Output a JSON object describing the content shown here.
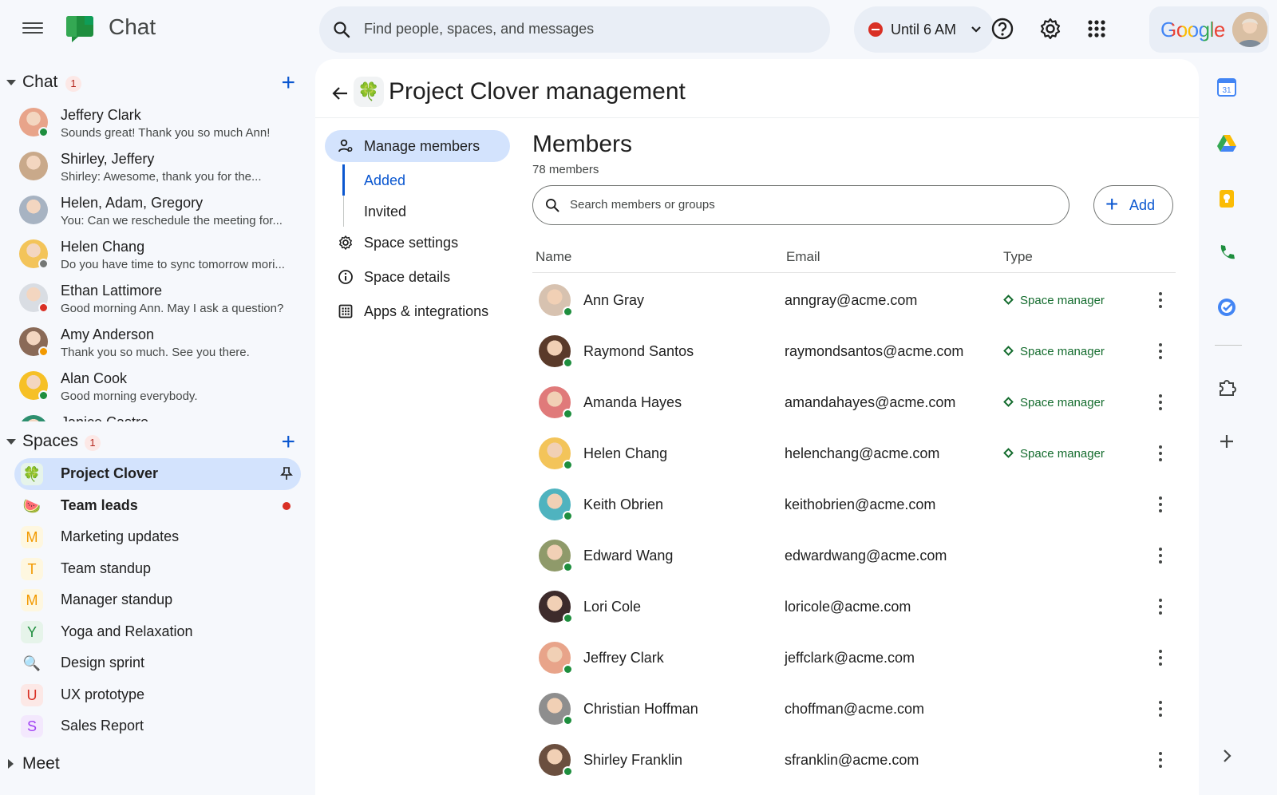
{
  "app": {
    "title": "Chat"
  },
  "search": {
    "placeholder": "Find people, spaces, and messages"
  },
  "status": {
    "label": "Until 6 AM"
  },
  "brand": {
    "google": "Google"
  },
  "sidebar": {
    "chat_section": {
      "title": "Chat",
      "badge": "1"
    },
    "dms": [
      {
        "name": "Jeffery Clark",
        "message": "Sounds great! Thank you so much Ann!",
        "color": "#e8a48a",
        "presence": "#1e8e3e"
      },
      {
        "name": "Shirley, Jeffery",
        "message": "Shirley: Awesome, thank you for the...",
        "color": "#c9a98a",
        "presence": ""
      },
      {
        "name": "Helen, Adam, Gregory",
        "message": "You: Can we reschedule the meeting for...",
        "color": "#a7b3c2",
        "presence": ""
      },
      {
        "name": "Helen Chang",
        "message": "Do you have time to sync tomorrow mori...",
        "color": "#f3c45a",
        "presence": "#747775"
      },
      {
        "name": "Ethan Lattimore",
        "message": "Good morning Ann. May I ask a question?",
        "color": "#d9dde3",
        "presence": "#d93025"
      },
      {
        "name": "Amy Anderson",
        "message": "Thank you so much. See you there.",
        "color": "#8a6a57",
        "presence": "#f29900"
      },
      {
        "name": "Alan Cook",
        "message": "Good morning everybody.",
        "color": "#f6c026",
        "presence": "#1e8e3e"
      },
      {
        "name": "Janice Castro",
        "message": "",
        "color": "#2d8f6f",
        "presence": ""
      }
    ],
    "spaces_section": {
      "title": "Spaces",
      "badge": "1"
    },
    "spaces": [
      {
        "name": "Project Clover",
        "icon": "🍀",
        "letter_color": "#1e8e3e",
        "bg": "#e6f4ea",
        "active": true,
        "bold": true,
        "unread": false
      },
      {
        "name": "Team leads",
        "icon": "🍉",
        "letter_color": "#d93025",
        "bg": "transparent",
        "active": false,
        "bold": true,
        "unread": true
      },
      {
        "name": "Marketing updates",
        "icon": "M",
        "letter_color": "#f29900",
        "bg": "#fef7e0",
        "active": false,
        "bold": false,
        "unread": false
      },
      {
        "name": "Team standup",
        "icon": "T",
        "letter_color": "#f29900",
        "bg": "#fef7e0",
        "active": false,
        "bold": false,
        "unread": false
      },
      {
        "name": "Manager standup",
        "icon": "M",
        "letter_color": "#f29900",
        "bg": "#fef7e0",
        "active": false,
        "bold": false,
        "unread": false
      },
      {
        "name": "Yoga and Relaxation",
        "icon": "Y",
        "letter_color": "#1e8e3e",
        "bg": "#e6f4ea",
        "active": false,
        "bold": false,
        "unread": false
      },
      {
        "name": "Design sprint",
        "icon": "🔍",
        "letter_color": "#d93025",
        "bg": "transparent",
        "active": false,
        "bold": false,
        "unread": false
      },
      {
        "name": "UX prototype",
        "icon": "U",
        "letter_color": "#d93025",
        "bg": "#fce8e6",
        "active": false,
        "bold": false,
        "unread": false
      },
      {
        "name": "Sales Report",
        "icon": "S",
        "letter_color": "#a142f4",
        "bg": "#f3e8fd",
        "active": false,
        "bold": false,
        "unread": false
      }
    ],
    "meet_section": {
      "title": "Meet"
    }
  },
  "main": {
    "space_icon": "🍀",
    "title": "Project Clover management",
    "nav": {
      "manage_members": "Manage members",
      "added": "Added",
      "invited": "Invited",
      "space_settings": "Space settings",
      "space_details": "Space details",
      "apps": "Apps & integrations"
    },
    "members": {
      "heading": "Members",
      "count": "78 members",
      "search_placeholder": "Search members or groups",
      "add_label": "Add",
      "columns": {
        "name": "Name",
        "email": "Email",
        "type": "Type"
      },
      "rows": [
        {
          "name": "Ann Gray",
          "email": "anngray@acme.com",
          "type": "Space manager",
          "color": "#d7c2b0"
        },
        {
          "name": "Raymond Santos",
          "email": "raymondsantos@acme.com",
          "type": "Space manager",
          "color": "#5a3a2a"
        },
        {
          "name": "Amanda Hayes",
          "email": "amandahayes@acme.com",
          "type": "Space manager",
          "color": "#e07a7a"
        },
        {
          "name": "Helen Chang",
          "email": "helenchang@acme.com",
          "type": "Space manager",
          "color": "#f3c45a"
        },
        {
          "name": "Keith Obrien",
          "email": "keithobrien@acme.com",
          "type": "",
          "color": "#4fb3bf"
        },
        {
          "name": "Edward Wang",
          "email": "edwardwang@acme.com",
          "type": "",
          "color": "#8f9a6a"
        },
        {
          "name": "Lori Cole",
          "email": "loricole@acme.com",
          "type": "",
          "color": "#3d2b2b"
        },
        {
          "name": "Jeffrey Clark",
          "email": "jeffclark@acme.com",
          "type": "",
          "color": "#e8a48a"
        },
        {
          "name": "Christian Hoffman",
          "email": "choffman@acme.com",
          "type": "",
          "color": "#8e8e8e"
        },
        {
          "name": "Shirley Franklin",
          "email": "sfranklin@acme.com",
          "type": "",
          "color": "#6b4f3f"
        }
      ]
    }
  }
}
